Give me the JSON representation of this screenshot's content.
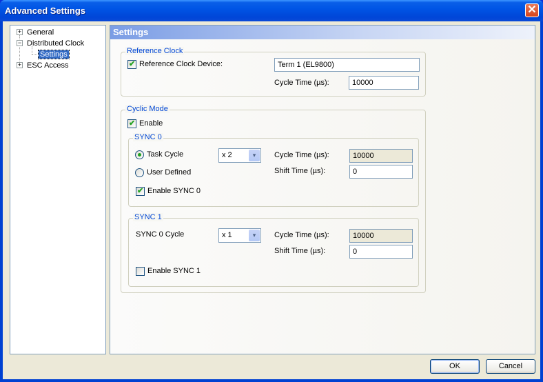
{
  "window": {
    "title": "Advanced Settings",
    "close_label": "✕"
  },
  "tree": {
    "items": [
      {
        "label": "General",
        "expander": "+"
      },
      {
        "label": "Distributed Clock",
        "expander": "−"
      },
      {
        "label": "Settings"
      },
      {
        "label": "ESC Access",
        "expander": "+"
      }
    ]
  },
  "panel": {
    "header": "Settings",
    "reference_clock": {
      "legend": "Reference Clock",
      "device_checkbox_label": "Reference Clock Device:",
      "device_checked": true,
      "device_value": "Term 1 (EL9800)",
      "cycle_time_label": "Cycle Time (µs):",
      "cycle_time_value": "10000"
    },
    "cyclic_mode": {
      "legend": "Cyclic Mode",
      "enable_label": "Enable",
      "enable_checked": true,
      "sync0": {
        "legend": "SYNC 0",
        "task_cycle_label": "Task Cycle",
        "task_cycle_selected": true,
        "user_defined_label": "User Defined",
        "multiplier": "x 2",
        "cycle_time_label": "Cycle Time (µs):",
        "cycle_time_value": "10000",
        "shift_time_label": "Shift Time (µs):",
        "shift_time_value": "0",
        "enable_label": "Enable SYNC 0",
        "enable_checked": true
      },
      "sync1": {
        "legend": "SYNC 1",
        "cycle_label": "SYNC 0 Cycle",
        "multiplier": "x 1",
        "cycle_time_label": "Cycle Time (µs):",
        "cycle_time_value": "10000",
        "shift_time_label": "Shift Time (µs):",
        "shift_time_value": "0",
        "enable_label": "Enable SYNC 1",
        "enable_checked": false
      }
    }
  },
  "buttons": {
    "ok": "OK",
    "cancel": "Cancel"
  },
  "icons": {
    "dropdown": "▾"
  }
}
